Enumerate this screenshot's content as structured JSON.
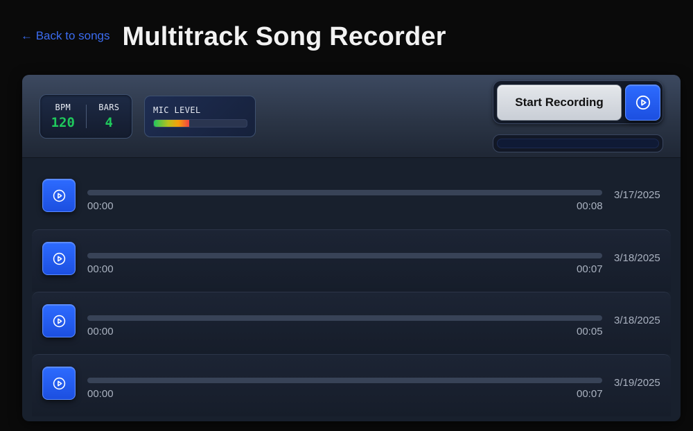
{
  "header": {
    "back_label": "← Back to songs",
    "title": "Multitrack Song Recorder"
  },
  "tempo": {
    "bpm_label": "BPM",
    "bpm_value": "120",
    "bars_label": "BARS",
    "bars_value": "4"
  },
  "mic": {
    "label": "MIC LEVEL",
    "level": 0.38
  },
  "recorder": {
    "record_label": "Start Recording",
    "play_icon": "play-circle-icon"
  },
  "tracks": [
    {
      "start": "00:00",
      "end": "00:08",
      "date": "3/17/2025",
      "progress": 0
    },
    {
      "start": "00:00",
      "end": "00:07",
      "date": "3/18/2025",
      "progress": 0
    },
    {
      "start": "00:00",
      "end": "00:05",
      "date": "3/18/2025",
      "progress": 0
    },
    {
      "start": "00:00",
      "end": "00:07",
      "date": "3/19/2025",
      "progress": 0
    }
  ],
  "colors": {
    "accent_blue": "#2563eb",
    "link_blue": "#3b6cf0",
    "value_green": "#1fc95c",
    "background": "#0a0a0a"
  }
}
